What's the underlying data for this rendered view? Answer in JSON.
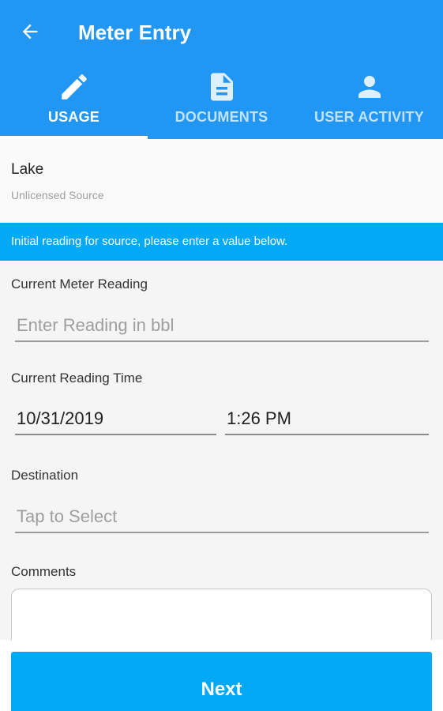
{
  "header": {
    "title": "Meter Entry",
    "back_icon": "arrow-left-icon",
    "color": "#2196f3"
  },
  "tabs": [
    {
      "label": "USAGE",
      "icon": "pencil-icon",
      "active": true
    },
    {
      "label": "DOCUMENTS",
      "icon": "document-icon",
      "active": false
    },
    {
      "label": "USER ACTIVITY",
      "icon": "person-icon",
      "active": false
    }
  ],
  "source": {
    "name": "Lake",
    "type": "Unlicensed Source"
  },
  "banner": {
    "text": "Initial reading for source, please enter a value below.",
    "color": "#03a9f4"
  },
  "form": {
    "meter_reading": {
      "label": "Current Meter Reading",
      "placeholder": "Enter Reading in bbl"
    },
    "reading_time": {
      "label": "Current Reading Time",
      "date": "10/31/2019",
      "time": "1:26 PM"
    },
    "destination": {
      "label": "Destination",
      "placeholder": "Tap to Select"
    },
    "comments": {
      "label": "Comments"
    }
  },
  "footer": {
    "next_label": "Next"
  }
}
